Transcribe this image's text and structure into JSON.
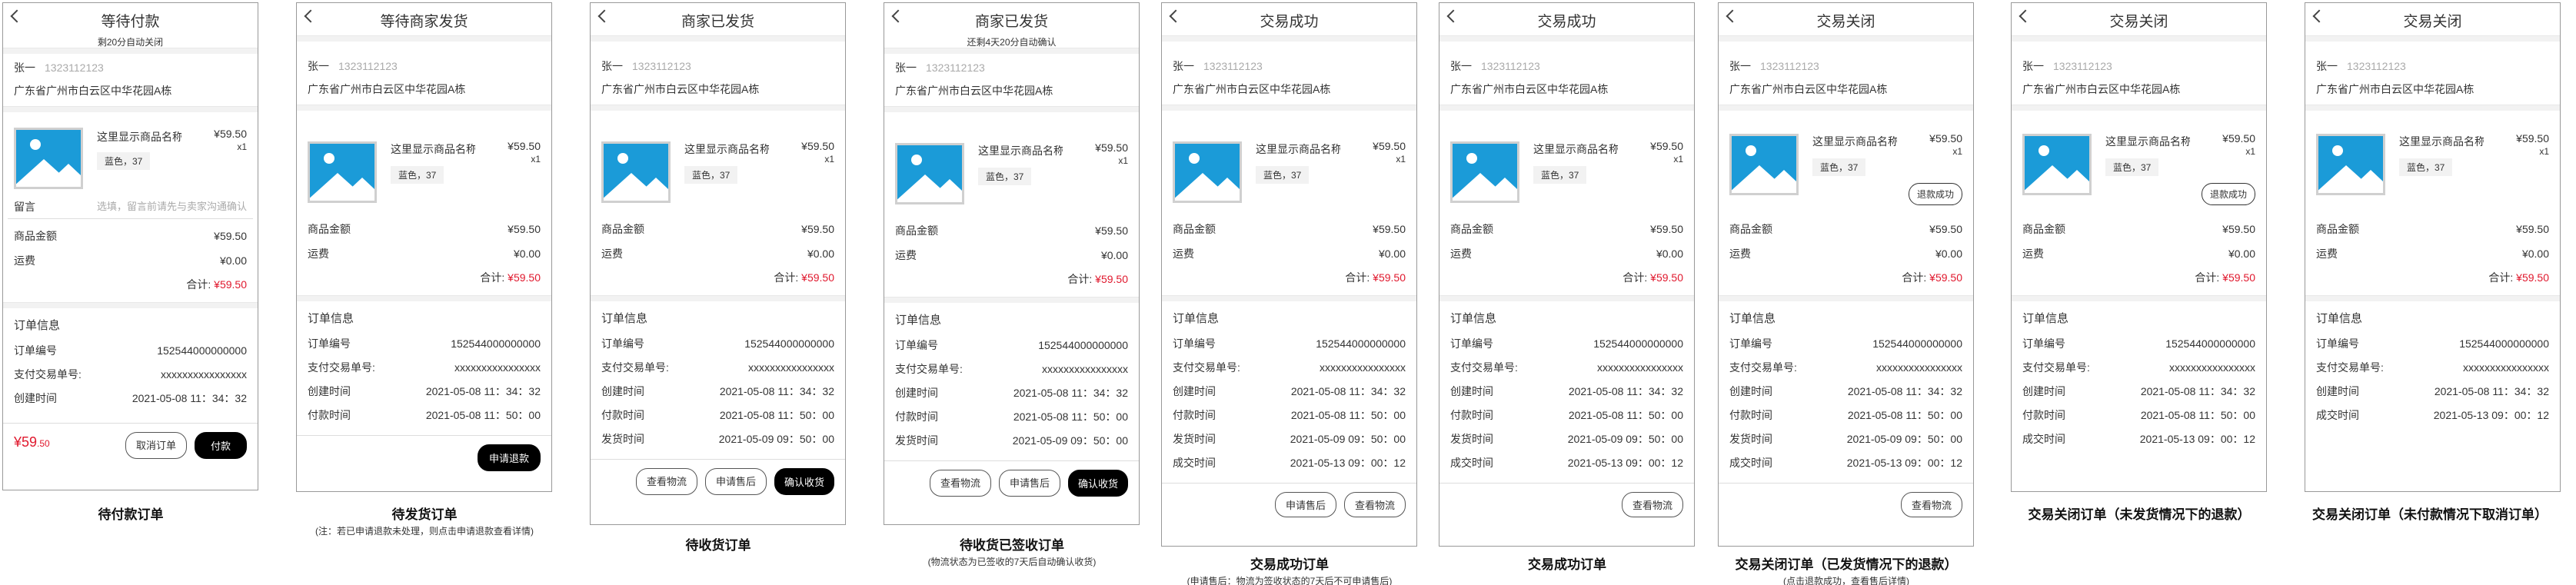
{
  "common": {
    "contact_name": "张一",
    "contact_phone": "1323112123",
    "address": "广东省广州市白云区中华花园A栋",
    "product_name": "这里显示商品名称...",
    "product_price": "¥59.50",
    "product_qty": "x1",
    "product_spec": "蓝色，37",
    "goods_amount_label": "商品金额",
    "goods_amount": "¥59.50",
    "shipping_label": "运费",
    "shipping_fee": "¥0.00",
    "total_label": "合计:",
    "total_value": "¥59.50",
    "order_info_title": "订单信息",
    "order_no_label": "订单编号",
    "order_no": "152544000000000",
    "trade_no_label": "支付交易单号:",
    "trade_no": "xxxxxxxxxxxxxxxx",
    "created_label": "创建时间",
    "created_time": "2021-05-08 11：34：32",
    "paid_label": "付款时间",
    "paid_time": "2021-05-08 11：50：00",
    "shipped_label": "发货时间",
    "shipped_time": "2021-05-09 09：50：00",
    "completed_label": "成交时间",
    "completed_time": "2021-05-13 09：00：12",
    "refund_success": "退款成功"
  },
  "screens": [
    {
      "title": "等待付款",
      "subtitle": "剩20分自动关闭",
      "message_label": "留言",
      "message_placeholder": "选填，留言前请先与卖家沟通确认",
      "bottom_price": "¥59",
      "bottom_price_cents": ".50",
      "cancel_button": "取消订单",
      "pay_button": "付款",
      "caption": "待付款订单"
    },
    {
      "title": "等待商家发货",
      "apply_refund_button": "申请退款",
      "caption": "待发货订单",
      "caption_note": "(注：若已申请退款未处理，则点击申请退款查看详情)"
    },
    {
      "title": "商家已发货",
      "view_logistics_button": "查看物流",
      "after_sale_button": "申请售后",
      "confirm_receipt_button": "确认收货",
      "caption": "待收货订单"
    },
    {
      "title": "商家已发货",
      "subtitle": "还剩4天20分自动确认",
      "view_logistics_button": "查看物流",
      "after_sale_button": "申请售后",
      "confirm_receipt_button": "确认收货",
      "caption": "待收货已签收订单",
      "caption_note": "(物流状态为已签收的7天后自动确认收货)"
    },
    {
      "title": "交易成功",
      "after_sale_button": "申请售后",
      "view_logistics_button": "查看物流",
      "caption": "交易成功订单",
      "caption_note": "(申请售后：物流为签收状态的7天后不可申请售后)"
    },
    {
      "title": "交易成功",
      "view_logistics_button": "查看物流",
      "caption": "交易成功订单"
    },
    {
      "title": "交易关闭",
      "view_logistics_button": "查看物流",
      "caption": "交易关闭订单（已发货情况下的退款）",
      "caption_note": "(点击退款成功，查看售后详情)"
    },
    {
      "title": "交易关闭",
      "caption": "交易关闭订单（未发货情况下的退款）"
    },
    {
      "title": "交易关闭",
      "caption": "交易关闭订单（未付款情况下取消订单）"
    }
  ],
  "colors": {
    "price_red": "#e0182d",
    "image_blue": "#1b9bd8",
    "button_black": "#000000"
  },
  "icons": {
    "back": "chevron-left-icon",
    "image": "image-placeholder-icon"
  }
}
